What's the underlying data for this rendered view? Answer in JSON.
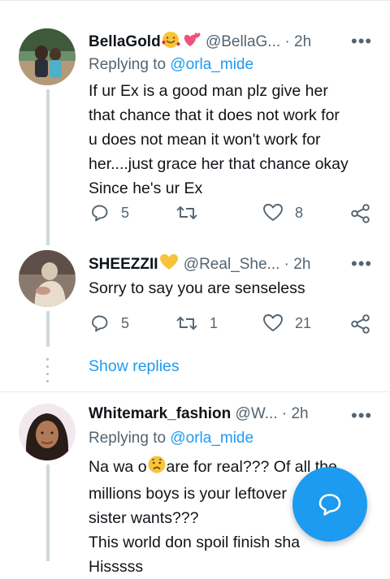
{
  "tweets": [
    {
      "name": "BellaGold",
      "name_emojis": [
        "smiling-face-with-hearts",
        "two-hearts"
      ],
      "handle": "@BellaG...",
      "time": "2h",
      "replying_prefix": "Replying to ",
      "replying_to": "@orla_mide",
      "text": "If ur Ex is a good man plz give her\nthat chance that it does not work for\nu does not mean it won't work for\nher....just grace her that chance okay\nSince he's ur Ex",
      "replies": "5",
      "retweets": "",
      "likes": "8"
    },
    {
      "name": "SHEEZZII",
      "name_emojis": [
        "yellow-heart"
      ],
      "handle": "@Real_She...",
      "time": "2h",
      "text": "Sorry to say you are senseless",
      "replies": "5",
      "retweets": "1",
      "likes": "21"
    },
    {
      "name": "Whitemark_fashion",
      "handle": "@W...",
      "time": "2h",
      "replying_prefix": "Replying to ",
      "replying_to": "@orla_mide",
      "text_line1_a": "Na wa o",
      "text_line1_b": "are for real??? Of all the",
      "text_rest": "millions boys is your leftover\nsister wants???\nThis world don spoil finish sha\nHisssss"
    }
  ],
  "thread": {
    "show_replies": "Show replies"
  },
  "dot": "·",
  "more": "•••",
  "colors": {
    "accent": "#1d9bf0",
    "muted": "#536471",
    "text": "#0f1419"
  }
}
